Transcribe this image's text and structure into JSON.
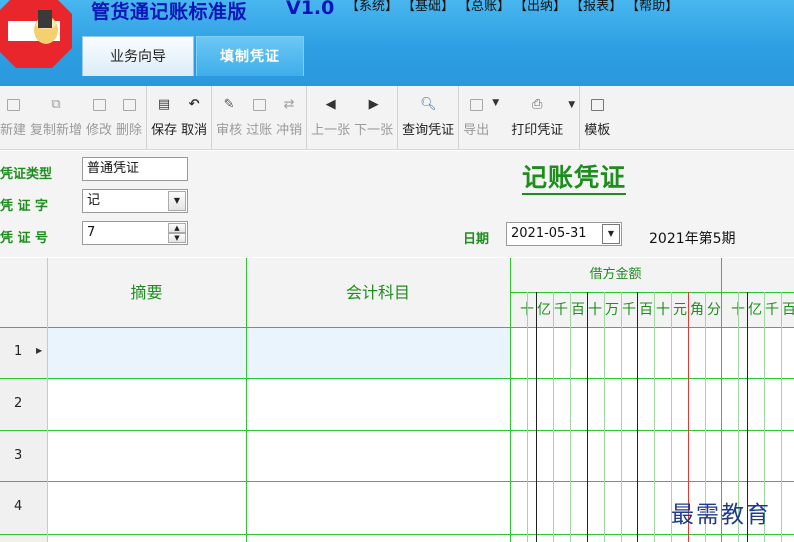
{
  "app": {
    "title": "管货通记账标准版",
    "version": "V1.0"
  },
  "top_menu": [
    "【系统】",
    "【基础】",
    "【总账】",
    "【出纳】",
    "【报表】",
    "【帮助】"
  ],
  "tabs": [
    {
      "label": "业务向导",
      "active": false
    },
    {
      "label": "填制凭证",
      "active": true
    }
  ],
  "toolbar": {
    "new": "新建",
    "copy_new": "复制新增",
    "edit": "修改",
    "delete": "删除",
    "save": "保存",
    "cancel": "取消",
    "audit": "审核",
    "post": "过账",
    "reverse": "冲销",
    "prev": "上一张",
    "next": "下一张",
    "query": "查询凭证",
    "export": "导出",
    "print": "打印凭证",
    "template": "模板"
  },
  "form": {
    "type_label": "凭证类型",
    "type_value": "普通凭证",
    "word_label": "凭 证 字",
    "word_value": "记",
    "number_label": "凭 证 号",
    "number_value": "7",
    "title": "记账凭证",
    "date_label": "日期",
    "date_value": "2021-05-31",
    "period": "2021年第5期"
  },
  "grid": {
    "headers": {
      "summary": "摘要",
      "account": "会计科目",
      "debit": "借方金额"
    },
    "debit_digits": [
      "十",
      "亿",
      "千",
      "百",
      "十",
      "万",
      "千",
      "百",
      "十",
      "元",
      "角",
      "分"
    ],
    "credit_digits": [
      "十",
      "亿",
      "千",
      "百"
    ],
    "rows": [
      "1",
      "2",
      "3",
      "4"
    ]
  },
  "watermark": "最需教育",
  "colors": {
    "accent_green": "#1d8e1d",
    "title_blue": "#0b16b8",
    "band_blue": "#2d9fe2",
    "yuan_line": "#e53935"
  }
}
